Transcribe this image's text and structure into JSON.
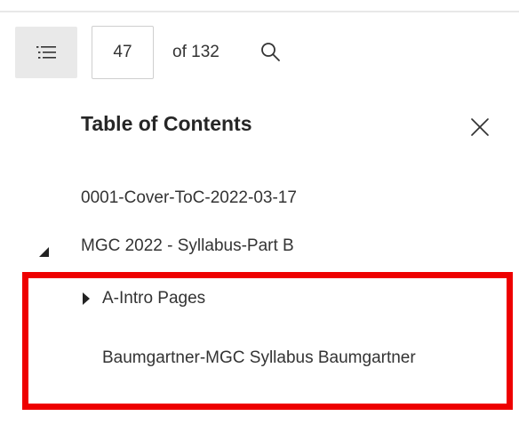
{
  "toolbar": {
    "toc_toggle_icon": "list-icon",
    "page_number": "47",
    "page_total_label": "of 132",
    "search_icon": "search-icon"
  },
  "toc": {
    "title": "Table of Contents",
    "close_icon": "close-icon",
    "items": [
      {
        "label": "0001-Cover-ToC-2022-03-17"
      },
      {
        "label": "MGC 2022 - Syllabus-Part B",
        "expanded": true
      },
      {
        "label": "A-Intro Pages",
        "expanded": false
      },
      {
        "label": "Baumgartner-MGC Syllabus Baumgartner"
      }
    ]
  },
  "colors": {
    "highlight": "#ee0000",
    "toggle_bg": "#e9e9e9"
  }
}
